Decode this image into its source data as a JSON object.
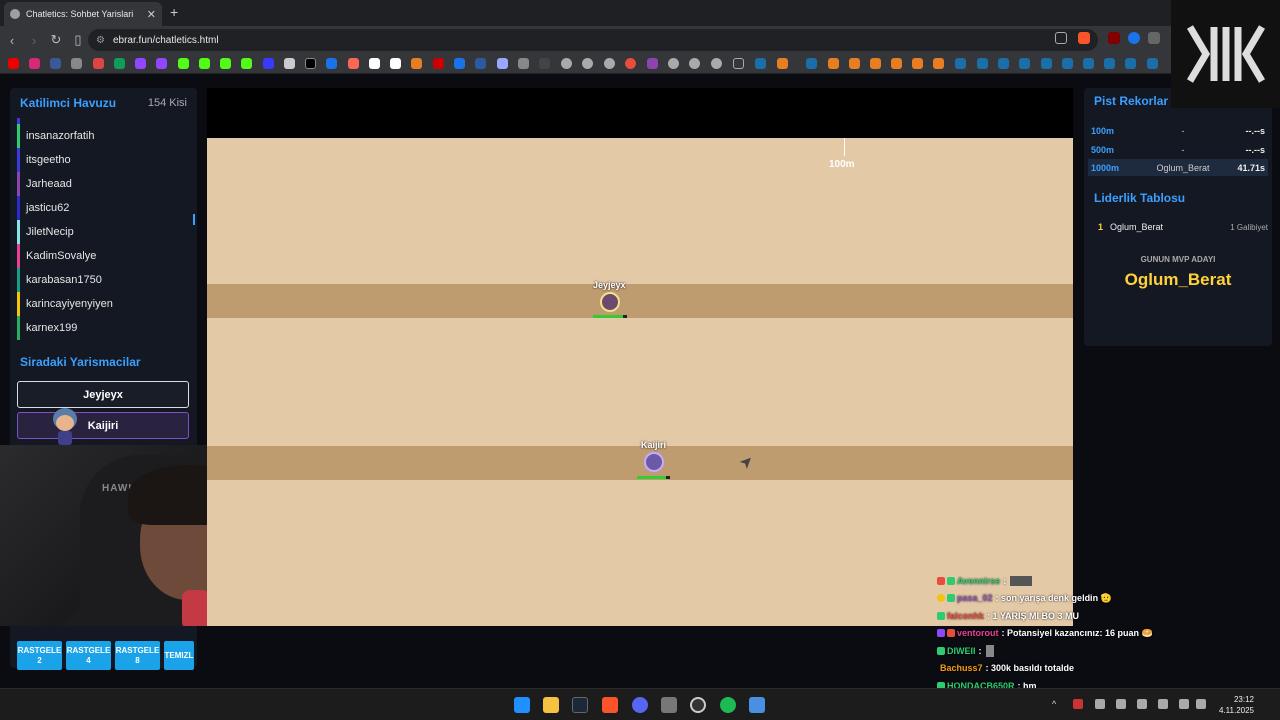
{
  "browser": {
    "tab_title": "Chatletics: Sohbet Yarislari",
    "url": "ebrar.fun/chatletics.html",
    "new_tab_symbol": "+",
    "close_symbol": "✕"
  },
  "left_panel": {
    "title": "Katilimci Havuzu",
    "count": "154 Kisi",
    "participants": [
      {
        "name": "insanazorfatih",
        "color": "#2ecc71"
      },
      {
        "name": "itsgeetho",
        "color": "#3a3adf"
      },
      {
        "name": "Jarheaad",
        "color": "#8e44ad"
      },
      {
        "name": "jasticu62",
        "color": "#2b2bd0"
      },
      {
        "name": "JiletNecip",
        "color": "#8ae6e6"
      },
      {
        "name": "KadimSovalye",
        "color": "#e84393"
      },
      {
        "name": "karabasan1750",
        "color": "#16a085"
      },
      {
        "name": "karincayiyenyiyen",
        "color": "#f1c40f"
      },
      {
        "name": "karnex199",
        "color": "#27ae60"
      }
    ],
    "queue_title": "Siradaki Yarismacilar",
    "queue": [
      "Jeyjeyx",
      "Kaijiri"
    ]
  },
  "random_buttons": [
    {
      "label": "RASTGELE",
      "value": "2"
    },
    {
      "label": "RASTGELE",
      "value": "4"
    },
    {
      "label": "RASTGELE",
      "value": "8"
    },
    {
      "label": "TEMIZL",
      "value": ""
    }
  ],
  "game": {
    "distance_marker": "100m",
    "runners": [
      {
        "name": "Jeyjeyx"
      },
      {
        "name": "Kaijiri"
      }
    ]
  },
  "right_panel": {
    "records_title": "Pist Rekorlar",
    "records": [
      {
        "distance": "100m",
        "holder": "-",
        "time": "--.--s"
      },
      {
        "distance": "500m",
        "holder": "-",
        "time": "--.--s"
      },
      {
        "distance": "1000m",
        "holder": "Oglum_Berat",
        "time": "41.71s"
      }
    ],
    "leaderboard_title": "Liderlik Tablosu",
    "leaderboard": [
      {
        "rank": "1",
        "name": "Oglum_Berat",
        "wins": "1 Galibiyet"
      }
    ],
    "mvp_label": "GUNUN MVP ADAYI",
    "mvp_name": "Oglum_Berat"
  },
  "chat": [
    {
      "user": "Avennirse",
      "text": ":",
      "color": "#2ecc71"
    },
    {
      "user": "pasa_02",
      "text": ": son yarışa denk geldin 🫡",
      "color": "#9b59b6"
    },
    {
      "user": "falconhk",
      "text": ": 1 YARIŞ MI BO 3 MU",
      "color": "#e74c3c"
    },
    {
      "user": "ventorout",
      "text": ": Potansiyel kazancınız: 16 puan 🥯",
      "color": "#e84393"
    },
    {
      "user": "DIWEII",
      "text": ":",
      "color": "#2ecc71"
    },
    {
      "user": "Bachuss7",
      "text": ": 300k basıldı totalde",
      "color": "#f39c12"
    },
    {
      "user": "HONDACB650R",
      "text": ": hm",
      "color": "#2ecc71"
    }
  ],
  "taskbar": {
    "time": "23:12",
    "date": "4.11.2025"
  }
}
